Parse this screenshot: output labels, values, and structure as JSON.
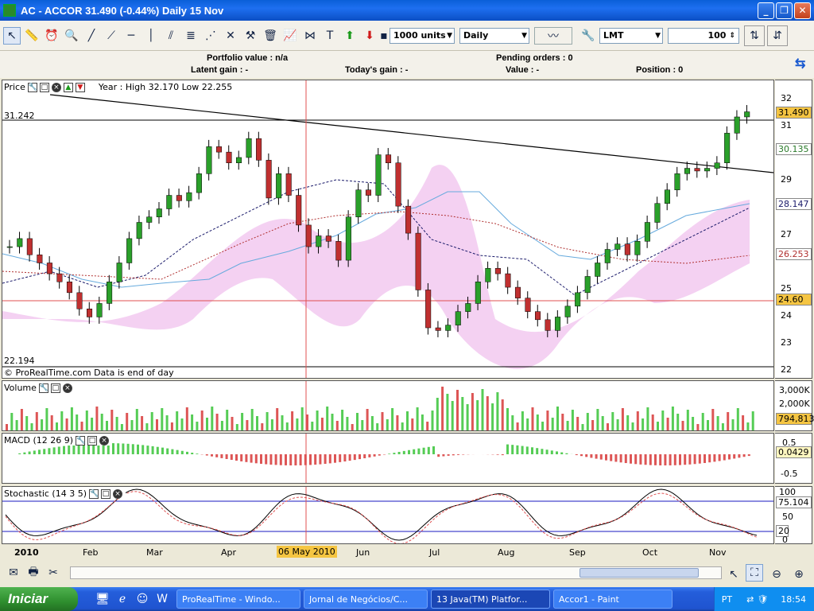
{
  "window": {
    "title": "AC - ACCOR    31.490 (-0.44%)    Daily  15 Nov"
  },
  "toolbar": {
    "units": "1000 units",
    "period": "Daily",
    "order_type": "LMT",
    "quantity": "100"
  },
  "info": {
    "portfolio_label": "Portfolio value : n/a",
    "latent_label": "Latent gain : -",
    "todays_label": "Today's gain : -",
    "pending_label": "Pending orders : 0",
    "value_label": "Value : -",
    "position_label": "Position : 0"
  },
  "price_panel": {
    "title": "Price",
    "year_info": "Year : High 32.170 Low 22.255",
    "level_top": "31.242",
    "level_bottom": "22.194",
    "footer": "© ProRealTime.com  Data is end of day",
    "last_price": "31.490",
    "ma_fast": "30.135",
    "ma_mid": "28.147",
    "ma_slow": "26.253",
    "cursor_price": "24.60",
    "axis": [
      "32",
      "31",
      "30",
      "29",
      "28",
      "27",
      "26",
      "25",
      "24",
      "23",
      "22"
    ]
  },
  "volume_panel": {
    "title": "Volume",
    "last": "794,813",
    "axis": [
      "3,000K",
      "2,000K",
      "1,000K"
    ]
  },
  "macd_panel": {
    "title": "MACD (12 26 9)",
    "last": "0.0429",
    "axis": [
      "0.5",
      "0",
      "-0.5"
    ]
  },
  "stoch_panel": {
    "title": "Stochastic (14 3 5)",
    "last": "75.104",
    "level": "20",
    "axis": [
      "100",
      "50",
      "0"
    ]
  },
  "xaxis": {
    "labels": [
      "2010",
      "Feb",
      "Mar",
      "Apr",
      "06 May 2010",
      "Jun",
      "Jul",
      "Aug",
      "Sep",
      "Oct",
      "Nov"
    ]
  },
  "taskbar": {
    "start": "Iniciar",
    "tasks": [
      "ProRealTime - Windo...",
      "Jornal de Negócios/C...",
      "13 Java(TM) Platfor...",
      "Accor1 - Paint"
    ],
    "lang": "PT",
    "clock": "18:54"
  },
  "chart_data": {
    "type": "candlestick",
    "title": "AC - ACCOR",
    "ylim": [
      22,
      32.3
    ],
    "x_months": [
      "2010",
      "Feb",
      "Mar",
      "Apr",
      "Jun",
      "Jul",
      "Aug",
      "Sep",
      "Oct",
      "Nov"
    ],
    "close_series": [
      26.5,
      26.8,
      26.2,
      25.9,
      25.5,
      25.2,
      24.8,
      24.2,
      23.9,
      24.4,
      25.2,
      25.9,
      26.8,
      27.4,
      27.6,
      27.9,
      28.4,
      28.2,
      28.5,
      29.2,
      30.2,
      30.0,
      29.6,
      29.8,
      30.5,
      29.7,
      28.3,
      29.2,
      28.4,
      27.3,
      26.5,
      26.9,
      26.7,
      26.0,
      27.6,
      28.6,
      28.4,
      29.9,
      29.6,
      28.0,
      27.0,
      24.9,
      23.5,
      23.4,
      23.6,
      24.1,
      24.4,
      25.2,
      25.7,
      25.5,
      25.0,
      24.6,
      24.1,
      23.8,
      23.4,
      23.9,
      24.3,
      24.8,
      25.4,
      25.9,
      26.4,
      26.6,
      26.2,
      26.7,
      27.4,
      28.1,
      28.6,
      29.2,
      29.4,
      29.3,
      29.4,
      29.6,
      30.7,
      31.3,
      31.49
    ],
    "support_line": 24.6,
    "resistance_line": 31.242
  }
}
